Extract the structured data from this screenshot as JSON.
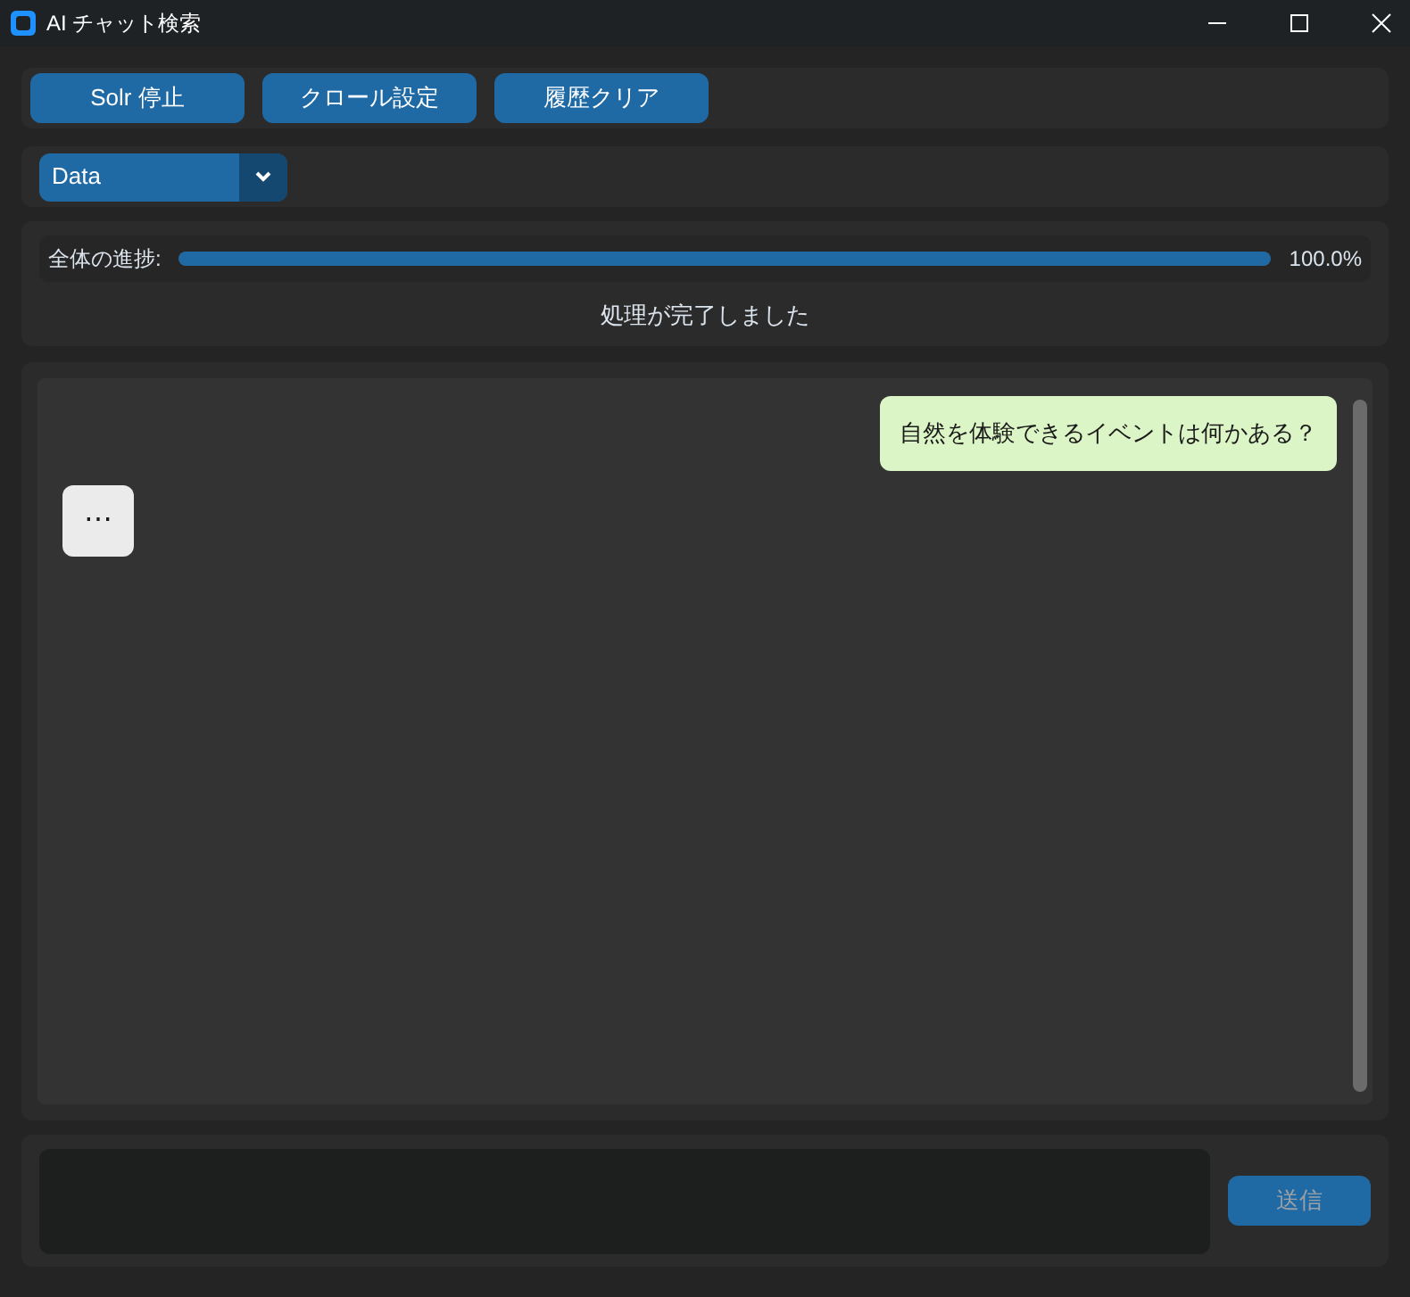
{
  "window": {
    "title": "AI チャット検索"
  },
  "toolbar": {
    "buttons": [
      "Solr 停止",
      "クロール設定",
      "履歴クリア"
    ]
  },
  "collection_select": {
    "value": "Data"
  },
  "progress": {
    "label": "全体の進捗:",
    "level": 1,
    "reading": "100.0%",
    "status": "処理が完了しました"
  },
  "messages": [
    {
      "kind": "user",
      "text": "自然を体験できるイベントは何かある？"
    },
    {
      "kind": "typing",
      "text": "⋯"
    }
  ],
  "composer": {
    "send_button": {
      "label": "送信",
      "disabled": true
    }
  }
}
